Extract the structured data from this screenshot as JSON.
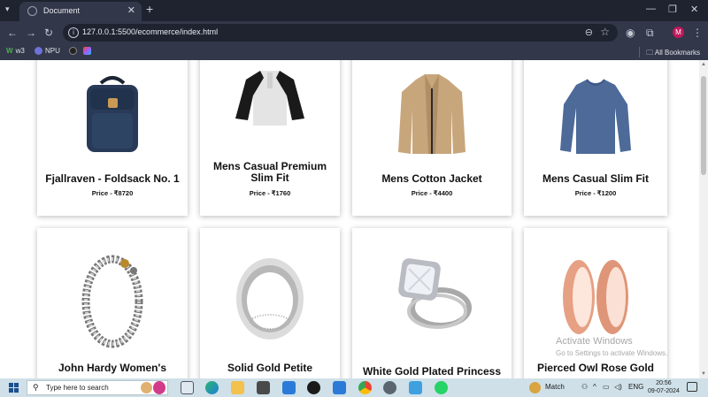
{
  "browser": {
    "tab_title": "Document",
    "url": "127.0.0.1:5500/ecommerce/index.html",
    "profile_initial": "M",
    "bookmarks": [
      "w3",
      "NPU"
    ],
    "all_bookmarks_label": "All Bookmarks"
  },
  "products": [
    {
      "name": "Fjallraven - Foldsack No. 1",
      "price": "Price - ₹8720",
      "icon": "backpack"
    },
    {
      "name": "Mens Casual Premium Slim Fit",
      "price": "Price - ₹1760",
      "icon": "raglan-tshirt"
    },
    {
      "name": "Mens Cotton Jacket",
      "price": "Price - ₹4400",
      "icon": "jacket"
    },
    {
      "name": "Mens Casual Slim Fit",
      "price": "Price - ₹1200",
      "icon": "long-sleeve-shirt"
    },
    {
      "name": "John Hardy Women's",
      "price": "",
      "icon": "chain-bracelet"
    },
    {
      "name": "Solid Gold Petite",
      "price": "",
      "icon": "silver-ring"
    },
    {
      "name": "White Gold Plated Princess",
      "price": "",
      "icon": "diamond-ring"
    },
    {
      "name": "Pierced Owl Rose Gold",
      "price": "",
      "icon": "rose-gold-tunnels"
    }
  ],
  "watermark": {
    "line1": "Activate Windows",
    "line2": "Go to Settings to activate Windows."
  },
  "taskbar": {
    "search_placeholder": "Type here to search",
    "weather_label": "Match",
    "language": "ENG",
    "time": "20:56",
    "date": "09-07-2024"
  }
}
